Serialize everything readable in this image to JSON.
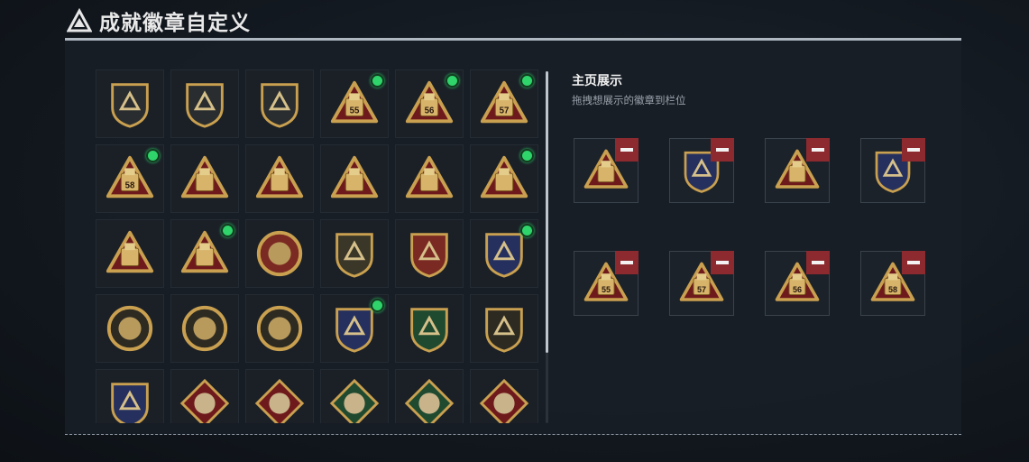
{
  "header": {
    "title": "成就徽章自定义"
  },
  "showcase": {
    "title": "主页展示",
    "subtitle": "拖拽想展示的徽章到栏位"
  },
  "colors": {
    "gold": "#c9a050",
    "red": "#6e1a1c",
    "green": "#2fd46b",
    "navy": "#25305e",
    "remove": "#8c2a2f"
  },
  "grid": [
    {
      "icon": "triangle-emblem-badge",
      "shape": "shield",
      "bg": "#2a2d2f",
      "text": "",
      "dot": false
    },
    {
      "icon": "helicopter-badge",
      "shape": "shield",
      "bg": "#2a2d2f",
      "text": "",
      "dot": false
    },
    {
      "icon": "sword-shield-badge",
      "shape": "shield",
      "bg": "#2a2d2f",
      "text": "",
      "dot": false
    },
    {
      "icon": "bag-55-badge",
      "shape": "triangle",
      "bg": "#6e1a1c",
      "text": "55",
      "dot": true
    },
    {
      "icon": "box-56-badge",
      "shape": "triangle",
      "bg": "#6e1a1c",
      "text": "56",
      "dot": true
    },
    {
      "icon": "canister-57-badge",
      "shape": "triangle",
      "bg": "#6e1a1c",
      "text": "57",
      "dot": true
    },
    {
      "icon": "canister-58-badge",
      "shape": "triangle",
      "bg": "#6e1a1c",
      "text": "58",
      "dot": true
    },
    {
      "icon": "robot-badge",
      "shape": "triangle",
      "bg": "#6e1a1c",
      "text": "",
      "dot": false
    },
    {
      "icon": "gears-badge",
      "shape": "triangle",
      "bg": "#6e1a1c",
      "text": "",
      "dot": false
    },
    {
      "icon": "gold-bars-badge",
      "shape": "triangle",
      "bg": "#6e1a1c",
      "text": "",
      "dot": false
    },
    {
      "icon": "number-one-badge",
      "shape": "triangle",
      "bg": "#6e1a1c",
      "text": "",
      "dot": false
    },
    {
      "icon": "bottle-badge",
      "shape": "triangle",
      "bg": "#6e1a1c",
      "text": "",
      "dot": true
    },
    {
      "icon": "soldiers-badge",
      "shape": "triangle",
      "bg": "#6e1a1c",
      "text": "",
      "dot": false
    },
    {
      "icon": "rocket-badge",
      "shape": "triangle",
      "bg": "#6e1a1c",
      "text": "",
      "dot": true
    },
    {
      "icon": "star-medal-badge",
      "shape": "round",
      "bg": "#7a2a22",
      "text": "",
      "dot": false
    },
    {
      "icon": "chevron-shield-badge",
      "shape": "shield",
      "bg": "#3a3628",
      "text": "",
      "dot": false
    },
    {
      "icon": "royal-shield-badge",
      "shape": "shield",
      "bg": "#7a2a22",
      "text": "",
      "dot": false
    },
    {
      "icon": "eagle-shield-badge",
      "shape": "shield",
      "bg": "#25305e",
      "text": "",
      "dot": true
    },
    {
      "icon": "helmet-badge",
      "shape": "round",
      "bg": "#2d2a22",
      "text": "",
      "dot": false
    },
    {
      "icon": "skull-badge",
      "shape": "round",
      "bg": "#2d2a22",
      "text": "",
      "dot": false
    },
    {
      "icon": "gear-medal-badge",
      "shape": "round",
      "bg": "#2d2a22",
      "text": "",
      "dot": false
    },
    {
      "icon": "rifle-navy-badge",
      "shape": "shield",
      "bg": "#25305e",
      "text": "",
      "dot": true
    },
    {
      "icon": "rifle-green-badge",
      "shape": "shield",
      "bg": "#1f4a30",
      "text": "",
      "dot": false
    },
    {
      "icon": "arm-shield-badge",
      "shape": "shield",
      "bg": "#2d2a22",
      "text": "",
      "dot": false
    },
    {
      "icon": "crossed-guns-badge",
      "shape": "shield",
      "bg": "#25305e",
      "text": "",
      "dot": false
    },
    {
      "icon": "wolf-red-badge",
      "shape": "diamond",
      "bg": "#6e1a1c",
      "text": "",
      "dot": false
    },
    {
      "icon": "wolf-red-2-badge",
      "shape": "diamond",
      "bg": "#6e1a1c",
      "text": "",
      "dot": false
    },
    {
      "icon": "wasp-green-badge",
      "shape": "diamond",
      "bg": "#1f4a30",
      "text": "",
      "dot": false
    },
    {
      "icon": "hammer-green-badge",
      "shape": "diamond",
      "bg": "#1f4a30",
      "text": "",
      "dot": false
    },
    {
      "icon": "dragon-red-badge",
      "shape": "diamond",
      "bg": "#6e1a1c",
      "text": "",
      "dot": false
    }
  ],
  "slots": [
    {
      "icon": "bottle-badge",
      "shape": "triangle",
      "bg": "#6e1a1c",
      "text": ""
    },
    {
      "icon": "eagle-shield-badge",
      "shape": "shield",
      "bg": "#25305e",
      "text": ""
    },
    {
      "icon": "rocket-badge",
      "shape": "triangle",
      "bg": "#6e1a1c",
      "text": ""
    },
    {
      "icon": "rifle-navy-badge",
      "shape": "shield",
      "bg": "#25305e",
      "text": ""
    },
    {
      "icon": "bag-55-badge",
      "shape": "triangle",
      "bg": "#6e1a1c",
      "text": "55"
    },
    {
      "icon": "canister-57-badge",
      "shape": "triangle",
      "bg": "#6e1a1c",
      "text": "57"
    },
    {
      "icon": "box-56-badge",
      "shape": "triangle",
      "bg": "#6e1a1c",
      "text": "56"
    },
    {
      "icon": "canister-58-badge",
      "shape": "triangle",
      "bg": "#6e1a1c",
      "text": "58"
    }
  ]
}
